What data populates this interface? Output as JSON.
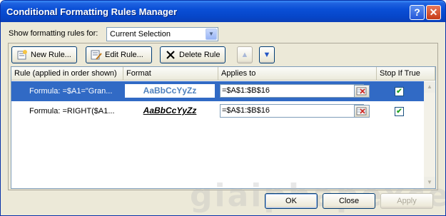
{
  "window": {
    "title": "Conditional Formatting Rules Manager"
  },
  "filter": {
    "label": "Show formatting rules for:",
    "selected": "Current Selection"
  },
  "toolbar": {
    "new_rule": "New Rule...",
    "edit_rule": "Edit Rule...",
    "delete_rule": "Delete Rule",
    "move_up_icon": "up-arrow-icon",
    "move_down_icon": "down-arrow-icon"
  },
  "grid": {
    "columns": [
      "Rule (applied in order shown)",
      "Format",
      "Applies to",
      "Stop If True"
    ],
    "rows": [
      {
        "rule": "Formula: =$A1=\"Gran...",
        "format_preview": "AaBbCcYyZz",
        "applies_to": "=$A$1:$B$16",
        "stop_if_true": true,
        "selected": true
      },
      {
        "rule": "Formula: =RIGHT($A1...",
        "format_preview": "AaBbCcYyZz",
        "applies_to": "=$A$1:$B$16",
        "stop_if_true": true,
        "selected": false
      }
    ]
  },
  "footer": {
    "ok": "OK",
    "close": "Close",
    "apply": "Apply"
  },
  "watermark": "giaiphapexcel",
  "colors": {
    "title_bar": "#0a4fd6",
    "selection": "#316ac5",
    "format_preview_text": "#4f81bd"
  }
}
